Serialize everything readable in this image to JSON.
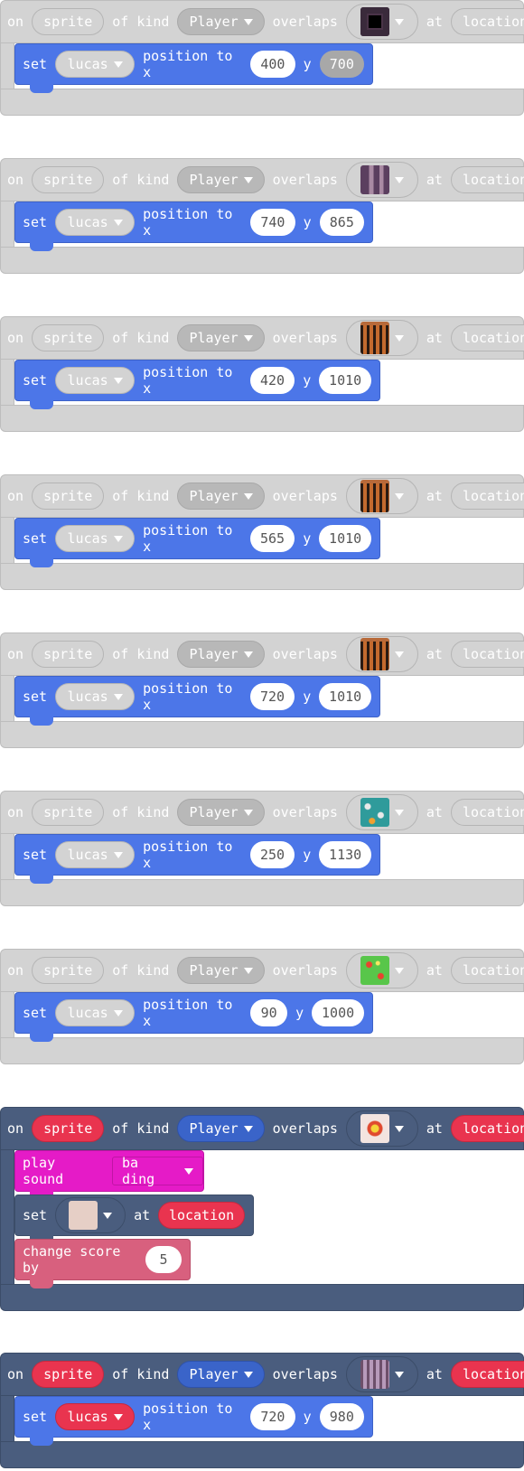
{
  "labels": {
    "on": "on",
    "of_kind": "of kind",
    "overlaps": "overlaps",
    "at": "at",
    "set": "set",
    "position_to_x": "position to x",
    "y": "y",
    "play_sound": "play sound",
    "change_score_by": "change score by"
  },
  "events": [
    {
      "state": "disabled",
      "sprite": "sprite",
      "kind": "Player",
      "tile_icon": "dark-tile-icon",
      "location": "location",
      "target": "lucas",
      "x": "400",
      "y": "700"
    },
    {
      "state": "disabled",
      "sprite": "sprite",
      "kind": "Player",
      "tile_icon": "purple-steps-tile-icon",
      "location": "location",
      "target": "lucas",
      "x": "740",
      "y": "865"
    },
    {
      "state": "disabled",
      "sprite": "sprite",
      "kind": "Player",
      "tile_icon": "gate-tile-icon",
      "location": "location",
      "target": "lucas",
      "x": "420",
      "y": "1010"
    },
    {
      "state": "disabled",
      "sprite": "sprite",
      "kind": "Player",
      "tile_icon": "gate-tile-icon",
      "location": "location",
      "target": "lucas",
      "x": "565",
      "y": "1010"
    },
    {
      "state": "disabled",
      "sprite": "sprite",
      "kind": "Player",
      "tile_icon": "gate-tile-icon",
      "location": "location",
      "target": "lucas",
      "x": "720",
      "y": "1010"
    },
    {
      "state": "disabled",
      "sprite": "sprite",
      "kind": "Player",
      "tile_icon": "teal-flower-tile-icon",
      "location": "location",
      "target": "lucas",
      "x": "250",
      "y": "1130"
    },
    {
      "state": "disabled",
      "sprite": "sprite",
      "kind": "Player",
      "tile_icon": "green-flower-tile-icon",
      "location": "location",
      "target": "lucas",
      "x": "90",
      "y": "1000"
    },
    {
      "state": "enabled",
      "sprite": "sprite",
      "kind": "Player",
      "tile_icon": "gem-tile-icon",
      "location": "location",
      "sound": "ba ding",
      "set_tile_icon": "blank-tile-icon",
      "score": "5"
    },
    {
      "state": "enabled",
      "sprite": "sprite",
      "kind": "Player",
      "tile_icon": "bars-tile-icon",
      "location": "location",
      "target": "lucas",
      "x": "720",
      "y": "980"
    }
  ],
  "colors": {
    "disabled_block": "#d3d3d3",
    "event_block": "#4a5d7e",
    "sprite_block": "#4c76e8",
    "sprite_var": "#e9344f",
    "music_block": "#e51bc7",
    "info_block": "#d8607e"
  }
}
